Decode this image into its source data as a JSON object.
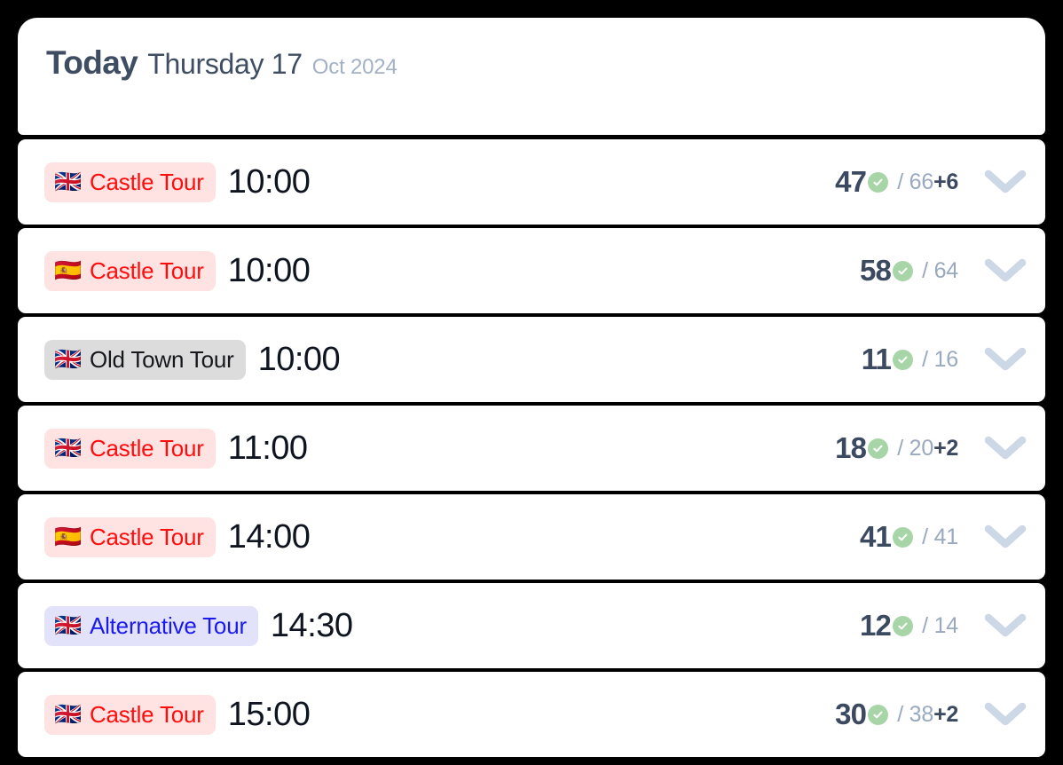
{
  "header": {
    "today_label": "Today",
    "weekday_day": "Thursday 17",
    "month_year": "Oct 2024"
  },
  "colors": {
    "page_background": "#000000",
    "card_background": "#ffffff",
    "header_text": "#3f4d63",
    "header_muted": "#a3b1c6",
    "time_text": "#0e1420",
    "count_booked": "#3b4a60",
    "count_capacity": "#99a9c0",
    "check_badge": "#a8d5a8",
    "chevron": "#ccd8e6",
    "badge_castle_bg": "#ffe2e2",
    "badge_castle_text": "#ff0d0d",
    "badge_oldtown_bg": "#dcdcdc",
    "badge_oldtown_text": "#16181d",
    "badge_alt_bg": "#e2e2fb",
    "badge_alt_text": "#1a1aee"
  },
  "icons": {
    "check": "check-circle-icon",
    "expand": "chevron-down-icon",
    "flag_uk": "flag-united-kingdom-icon",
    "flag_es": "flag-spain-icon"
  },
  "tours": [
    {
      "flag": "🇬🇧",
      "flag_name": "flag-united-kingdom-icon",
      "tour_name": "Castle Tour",
      "theme": "theme-castle",
      "time": "10:00",
      "booked": "47",
      "capacity": "/ 66",
      "extra": "+6"
    },
    {
      "flag": "🇪🇸",
      "flag_name": "flag-spain-icon",
      "tour_name": "Castle Tour",
      "theme": "theme-castle",
      "time": "10:00",
      "booked": "58",
      "capacity": "/ 64",
      "extra": ""
    },
    {
      "flag": "🇬🇧",
      "flag_name": "flag-united-kingdom-icon",
      "tour_name": "Old Town Tour",
      "theme": "theme-oldtown",
      "time": "10:00",
      "booked": "11",
      "capacity": "/ 16",
      "extra": ""
    },
    {
      "flag": "🇬🇧",
      "flag_name": "flag-united-kingdom-icon",
      "tour_name": "Castle Tour",
      "theme": "theme-castle",
      "time": "11:00",
      "booked": "18",
      "capacity": "/ 20",
      "extra": "+2"
    },
    {
      "flag": "🇪🇸",
      "flag_name": "flag-spain-icon",
      "tour_name": "Castle Tour",
      "theme": "theme-castle",
      "time": "14:00",
      "booked": "41",
      "capacity": "/ 41",
      "extra": ""
    },
    {
      "flag": "🇬🇧",
      "flag_name": "flag-united-kingdom-icon",
      "tour_name": "Alternative Tour",
      "theme": "theme-alt",
      "time": "14:30",
      "booked": "12",
      "capacity": "/ 14",
      "extra": ""
    },
    {
      "flag": "🇬🇧",
      "flag_name": "flag-united-kingdom-icon",
      "tour_name": "Castle Tour",
      "theme": "theme-castle",
      "time": "15:00",
      "booked": "30",
      "capacity": "/ 38",
      "extra": "+2"
    }
  ]
}
